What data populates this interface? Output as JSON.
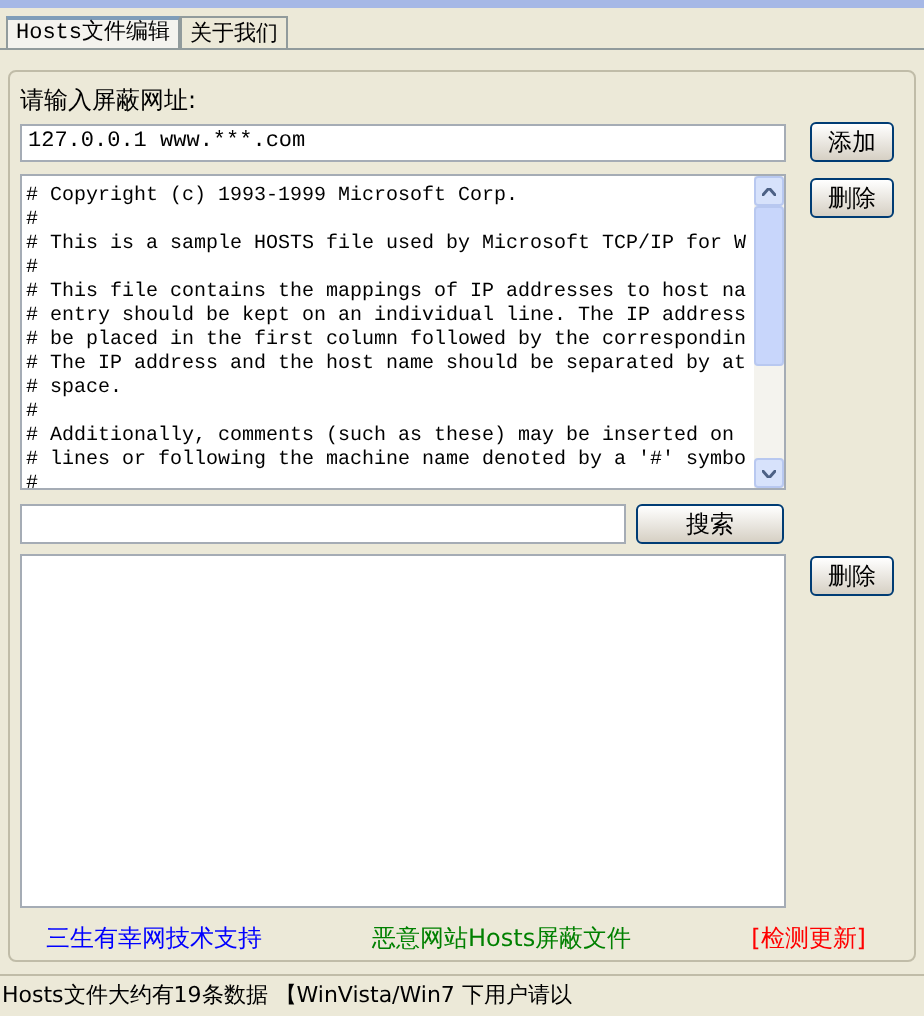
{
  "tabs": [
    {
      "label": "Hosts文件编辑",
      "selected": true
    },
    {
      "label": "关于我们",
      "selected": false
    }
  ],
  "address_label": "请输入屏蔽网址:",
  "address_field": {
    "value": "127.0.0.1 www.***.com"
  },
  "add_button": "添加",
  "delete_button": "删除",
  "hosts_text": [
    "# Copyright (c) 1993-1999 Microsoft Corp.",
    "#",
    "# This is a sample HOSTS file used by Microsoft TCP/IP for W",
    "#",
    "# This file contains the mappings of IP addresses to host na",
    "# entry should be kept on an individual line. The IP address",
    "# be placed in the first column followed by the correspondin",
    "# The IP address and the host name should be separated by at",
    "# space.",
    "#",
    "# Additionally, comments (such as these) may be inserted on",
    "# lines or following the machine name denoted by a '#' symbo",
    "#"
  ],
  "search_button": "搜索",
  "list_delete_button": "删除",
  "links": [
    {
      "label": "三生有幸网技术支持",
      "color": "#0000ff"
    },
    {
      "label": "恶意网站Hosts屏蔽文件",
      "color": "#008000"
    },
    {
      "label": "[检测更新]",
      "color": "#ff0000"
    }
  ],
  "status_bar": "Hosts文件大约有19条数据 【WinVista/Win7 下用户请以"
}
